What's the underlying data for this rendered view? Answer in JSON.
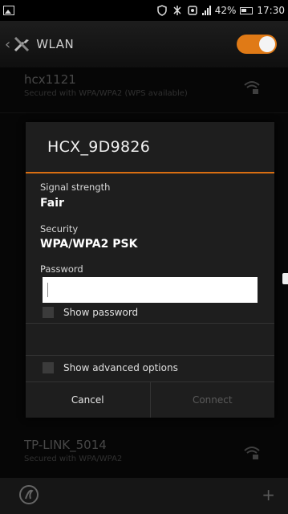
{
  "status_bar": {
    "battery": "42%",
    "time": "17:30"
  },
  "header": {
    "title": "WLAN"
  },
  "networks": [
    {
      "ssid": "hcx1121",
      "security": "Secured with WPA/WPA2 (WPS available)"
    },
    {
      "ssid": "TP-LINK_5014",
      "security": "Secured with WPA/WPA2"
    }
  ],
  "dialog": {
    "title": "HCX_9D9826",
    "signal_label": "Signal strength",
    "signal_value": "Fair",
    "security_label": "Security",
    "security_value": "WPA/WPA2 PSK",
    "password_label": "Password",
    "password_value": "",
    "show_password": "Show password",
    "show_advanced": "Show advanced options",
    "cancel": "Cancel",
    "connect": "Connect"
  },
  "colors": {
    "accent": "#d86e12",
    "toggle_on": "#e07a16"
  }
}
